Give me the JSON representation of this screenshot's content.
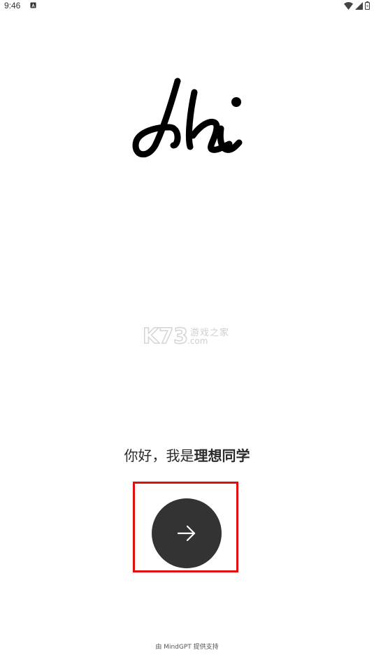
{
  "status_bar": {
    "time": "9:46"
  },
  "watermark": {
    "brand": "K73",
    "cn_text": "游戏之家",
    "domain": ".com"
  },
  "greeting": {
    "prefix": "你好，我是",
    "name": "理想同学"
  },
  "actions": {
    "next_icon": "arrow-right-icon"
  },
  "footer": {
    "text": "由 MindGPT 提供支持"
  },
  "colors": {
    "button_bg": "#333333",
    "highlight": "#e20d0d",
    "background": "#ffffff"
  }
}
